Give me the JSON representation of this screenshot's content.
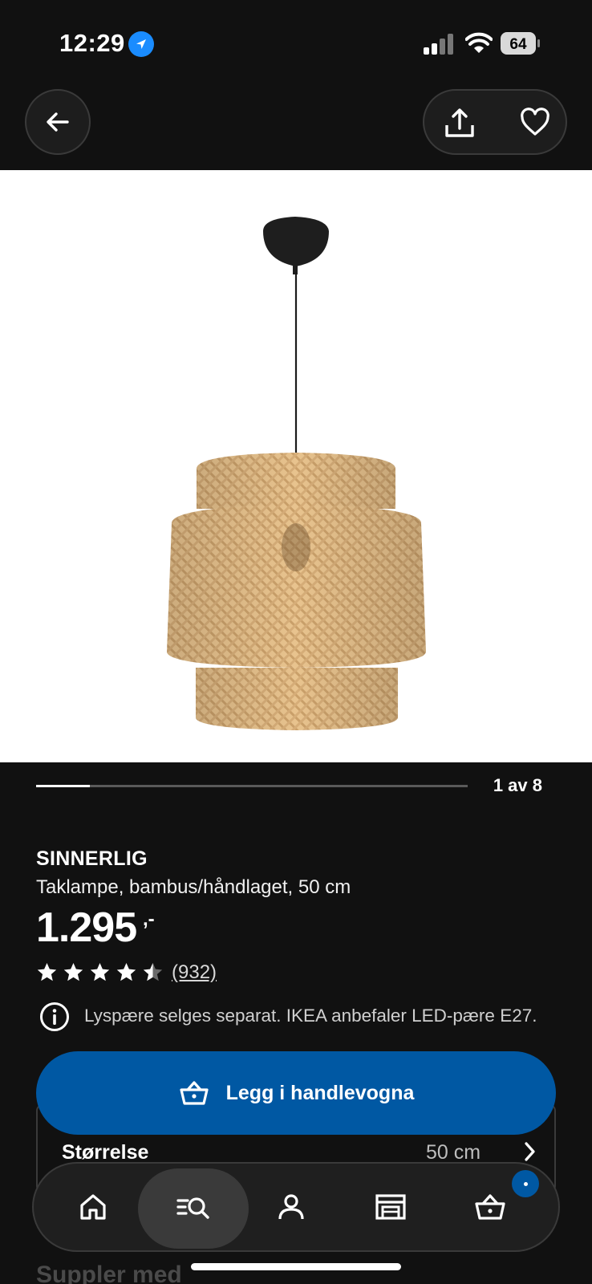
{
  "status_bar": {
    "time": "12:29",
    "battery": "64"
  },
  "carousel": {
    "counter": "1 av 8",
    "progress": 0.125
  },
  "product": {
    "name": "SINNERLIG",
    "description": "Taklampe, bambus/håndlaget, 50 cm",
    "price": "1.295",
    "price_suffix": ",-",
    "rating": 4.5,
    "reviews": "(932)",
    "info": "Lyspære selges separat. IKEA anbefaler LED-pære E27."
  },
  "actions": {
    "add_to_cart": "Legg i handlevogna"
  },
  "size": {
    "label": "Størrelse",
    "value": "50 cm"
  },
  "next_section": "Suppler med",
  "tabs": [
    "home",
    "search",
    "profile",
    "store",
    "cart"
  ],
  "icons": {
    "back": "arrow-left-icon",
    "share": "share-icon",
    "favorite": "heart-icon",
    "info": "info-icon",
    "cart": "basket-icon"
  },
  "colors": {
    "accent": "#0058a3",
    "background": "#111111"
  }
}
